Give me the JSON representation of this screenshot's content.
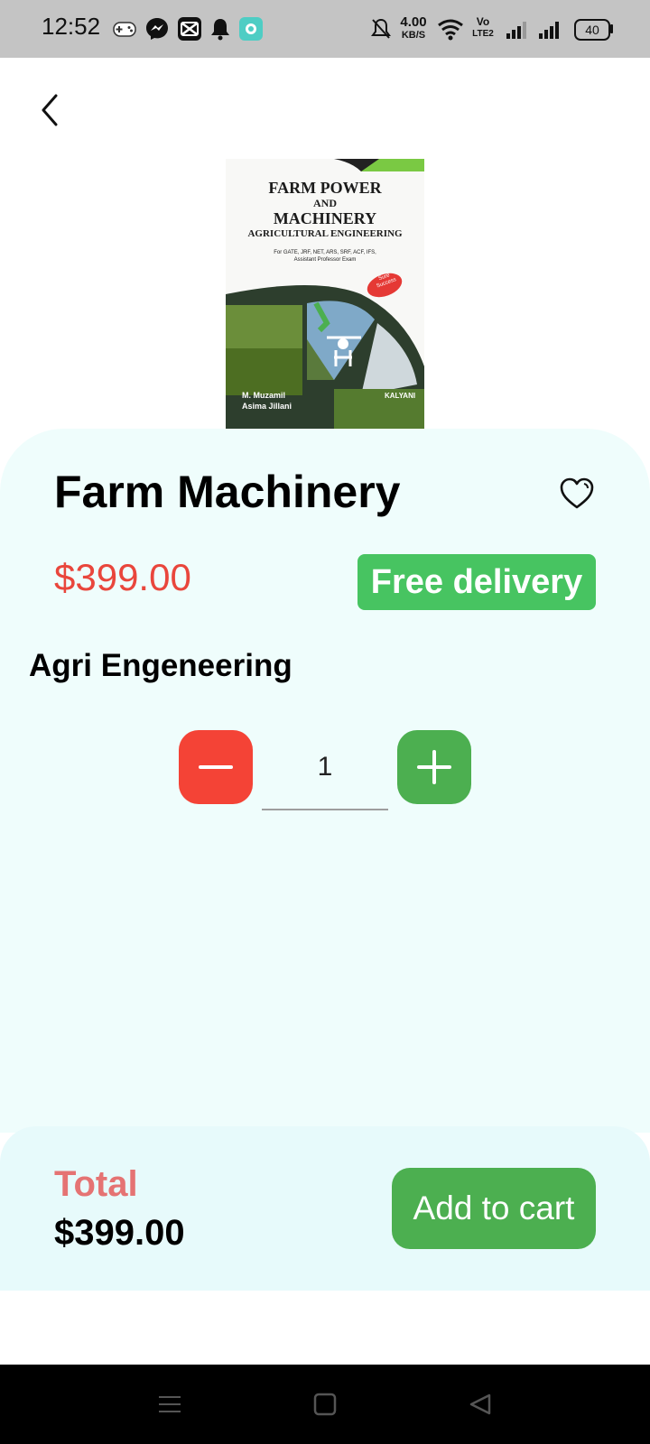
{
  "status_bar": {
    "time": "12:52",
    "net_speed_value": "4.00",
    "net_speed_unit": "KB/S",
    "volte_label": "Vo",
    "lte_label": "LTE2",
    "battery": "40",
    "icons": [
      "game-controller-icon",
      "messenger-icon",
      "capcut-icon",
      "notification-bell-icon",
      "app-icon",
      "bell-off-icon",
      "wifi-icon",
      "signal-icon",
      "signal-icon",
      "battery-icon"
    ]
  },
  "product": {
    "cover": {
      "title_line1": "FARM POWER",
      "title_line2": "AND",
      "title_line3": "MACHINERY",
      "subtitle": "AGRICULTURAL ENGINEERING",
      "exam_line1": "For GATE, JRF, NET, ARS, SRF, ACF, IFS,",
      "exam_line2": "Assistant Professor Exam",
      "sticker_line1": "Sure",
      "sticker_line2": "Success",
      "author_line1": "M. Muzamil",
      "author_line2": "Asima Jillani",
      "publisher": "KALYANI"
    },
    "name": "Farm Machinery",
    "price": "$399.00",
    "delivery_badge": "Free delivery",
    "category": "Agri Engeneering",
    "quantity": "1"
  },
  "footer": {
    "total_label": "Total",
    "total_value": "$399.00",
    "add_to_cart": "Add to cart"
  },
  "colors": {
    "price_red": "#e9463c",
    "badge_green": "#47c461",
    "minus_red": "#f44336",
    "plus_green": "#4caf50",
    "sheet_bg": "#effdfc",
    "total_label": "#e57373"
  }
}
